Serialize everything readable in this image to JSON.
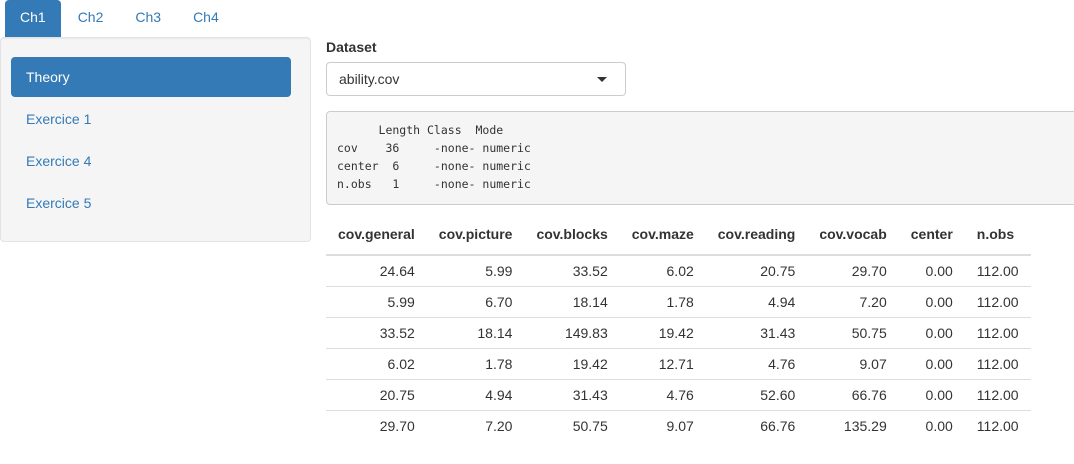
{
  "tabs": [
    {
      "label": "Ch1",
      "active": true
    },
    {
      "label": "Ch2",
      "active": false
    },
    {
      "label": "Ch3",
      "active": false
    },
    {
      "label": "Ch4",
      "active": false
    }
  ],
  "sidebar": {
    "items": [
      {
        "label": "Theory",
        "active": true
      },
      {
        "label": "Exercice 1",
        "active": false
      },
      {
        "label": "Exercice 4",
        "active": false
      },
      {
        "label": "Exercice 5",
        "active": false
      }
    ]
  },
  "dataset": {
    "label": "Dataset",
    "selected": "ability.cov"
  },
  "summary_output": "      Length Class  Mode   \ncov    36     -none- numeric\ncenter  6     -none- numeric\nn.obs   1     -none- numeric",
  "table": {
    "headers": [
      "cov.general",
      "cov.picture",
      "cov.blocks",
      "cov.maze",
      "cov.reading",
      "cov.vocab",
      "center",
      "n.obs"
    ],
    "rows": [
      [
        "24.64",
        "5.99",
        "33.52",
        "6.02",
        "20.75",
        "29.70",
        "0.00",
        "112.00"
      ],
      [
        "5.99",
        "6.70",
        "18.14",
        "1.78",
        "4.94",
        "7.20",
        "0.00",
        "112.00"
      ],
      [
        "33.52",
        "18.14",
        "149.83",
        "19.42",
        "31.43",
        "50.75",
        "0.00",
        "112.00"
      ],
      [
        "6.02",
        "1.78",
        "19.42",
        "12.71",
        "4.76",
        "9.07",
        "0.00",
        "112.00"
      ],
      [
        "20.75",
        "4.94",
        "31.43",
        "4.76",
        "52.60",
        "66.76",
        "0.00",
        "112.00"
      ],
      [
        "29.70",
        "7.20",
        "50.75",
        "9.07",
        "66.76",
        "135.29",
        "0.00",
        "112.00"
      ]
    ]
  },
  "colors": {
    "accent": "#337ab7",
    "sidebar_bg": "#f5f5f5"
  },
  "icons": {
    "select_caret": "caret-down-icon"
  }
}
